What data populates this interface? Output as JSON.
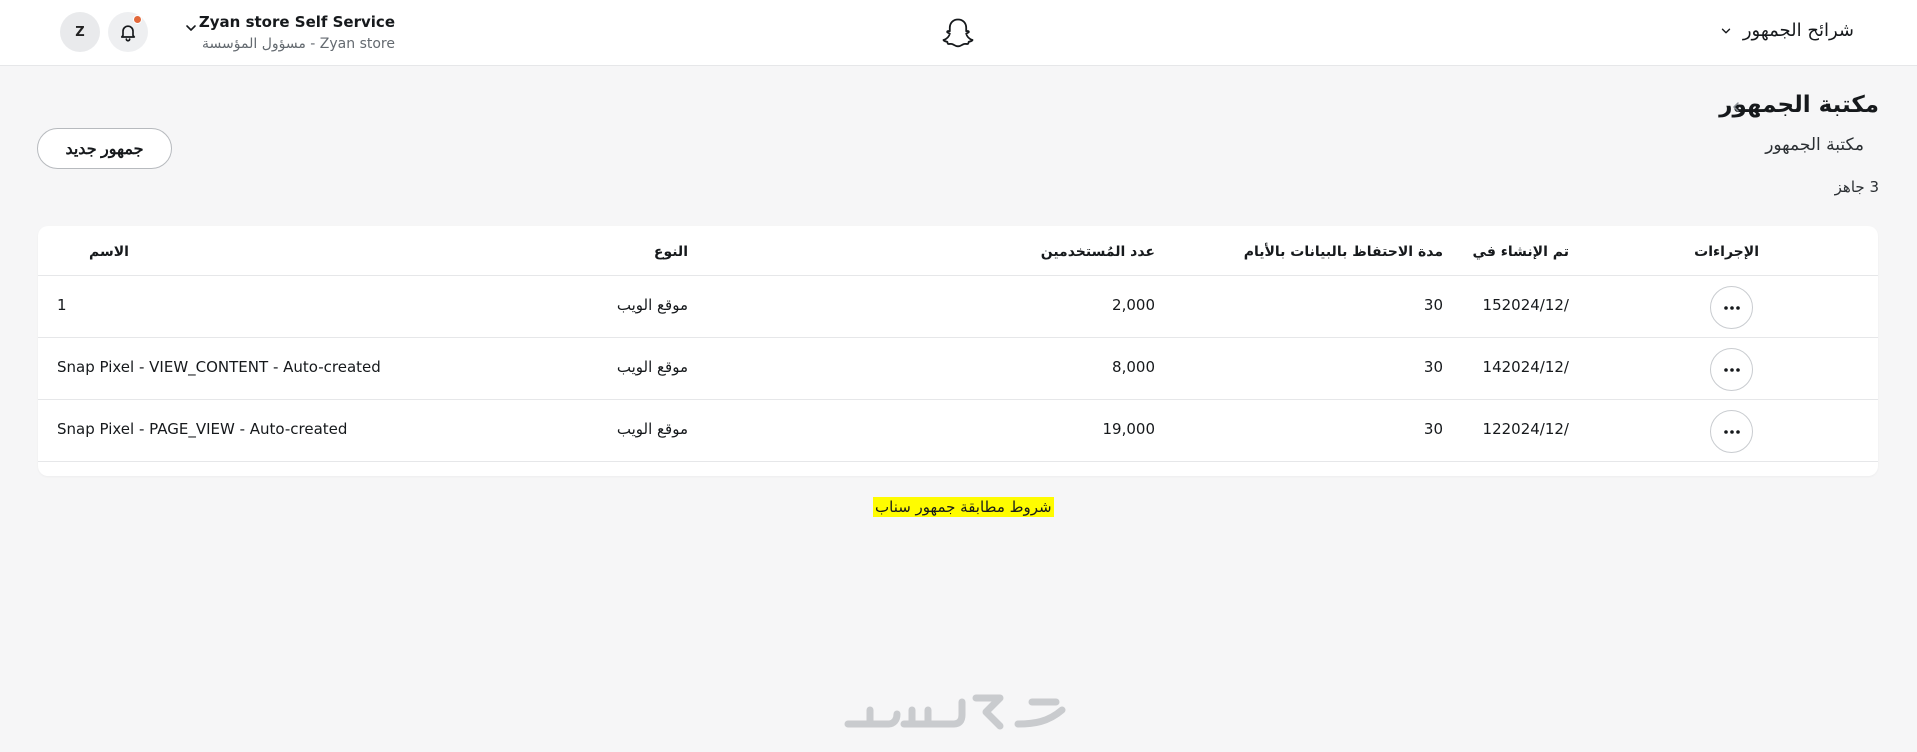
{
  "header": {
    "avatar_initial": "Z",
    "org_name": "Zyan store Self Service",
    "org_role": "Zyan store - مسؤول المؤسسة",
    "segments_menu_label": "شرائح الجمهور"
  },
  "page": {
    "title": "مكتبة الجمهور",
    "subtitle": "مكتبة الجمهور",
    "ready_count": "3 جاهز",
    "new_audience_label": "جمهور جديد"
  },
  "table": {
    "columns": {
      "actions": "الإجراءات",
      "created": "تم الإنشاء في",
      "retention": "مدة الاحتفاظ بالبيانات بالأيام",
      "users": "عدد المُستخدمين",
      "type": "النوع",
      "name": "الاسم"
    },
    "rows": [
      {
        "created": "152024/12/",
        "retention": "30",
        "users": "2,000",
        "type": "موقع الويب",
        "name": "1"
      },
      {
        "created": "142024/12/",
        "retention": "30",
        "users": "8,000",
        "type": "موقع الويب",
        "name": "Snap Pixel - VIEW_CONTENT - Auto-created"
      },
      {
        "created": "122024/12/",
        "retention": "30",
        "users": "19,000",
        "type": "موقع الويب",
        "name": "Snap Pixel - PAGE_VIEW - Auto-created"
      }
    ]
  },
  "footer": {
    "terms_link": "شروط مطابقة جمهور سناب"
  },
  "colors": {
    "accent_yellow": "#fffc00",
    "notification": "#e2683a",
    "watermark": "#c9cbce"
  },
  "icons": [
    "bell-icon",
    "chevron-down-icon",
    "snapchat-ghost-icon",
    "chevron-left-icon",
    "more-horizontal-icon",
    "watermark-logo"
  ]
}
